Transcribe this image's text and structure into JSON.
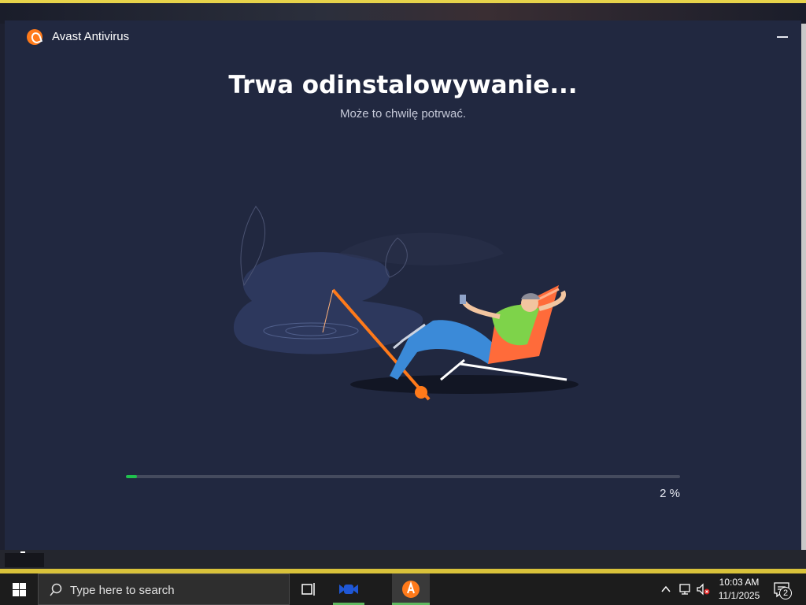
{
  "window": {
    "title": "Avast Antivirus",
    "heading": "Trwa odinstalowywanie...",
    "subheading": "Może to chwilę potrwać.",
    "progress_percent": 2,
    "progress_label": "2 %"
  },
  "taskbar": {
    "search_placeholder": "Type here to search",
    "clock_time": "10:03 AM",
    "clock_date": "11/1/2025",
    "notification_count": "2",
    "icons": [
      "windows-start-icon",
      "search-icon",
      "task-view-icon",
      "app-icon",
      "avast-icon",
      "chevron-up-icon",
      "network-icon",
      "volume-muted-icon",
      "notification-icon"
    ]
  },
  "colors": {
    "window_bg": "#212840",
    "accent_orange": "#ff7a1a",
    "progress_green": "#1fc24d",
    "taskbar_bg": "#1c1c1c"
  }
}
